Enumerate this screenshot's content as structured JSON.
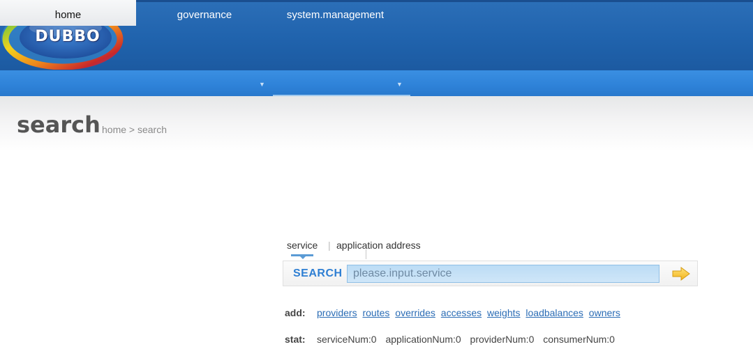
{
  "header": {
    "logo_text": "DUBBO",
    "brand_colors": {
      "header_blue": "#2063ad",
      "nav_blue": "#2e82d8",
      "link_blue": "#2a6cb5"
    }
  },
  "nav": {
    "items": [
      {
        "label": "home",
        "active": true,
        "has_dropdown": false
      },
      {
        "label": "governance",
        "active": false,
        "has_dropdown": true
      },
      {
        "label": "system.management",
        "active": false,
        "has_dropdown": true
      }
    ],
    "dropdown_icon": "triangle-down"
  },
  "page": {
    "title": "search",
    "breadcrumb": "home > search"
  },
  "search": {
    "tabs": [
      {
        "label": "service",
        "selected": true
      },
      {
        "label": "application address",
        "selected": false
      }
    ],
    "separator": "|",
    "label": "SEARCH",
    "placeholder": "please.input.service",
    "value": "",
    "go_icon": "arrow-right-icon"
  },
  "add": {
    "label": "add:",
    "links": [
      "providers",
      "routes",
      "overrides",
      "accesses",
      "weights",
      "loadbalances",
      "owners"
    ]
  },
  "stat": {
    "label": "stat:",
    "items": [
      "serviceNum:0",
      "applicationNum:0",
      "providerNum:0",
      "consumerNum:0"
    ]
  }
}
